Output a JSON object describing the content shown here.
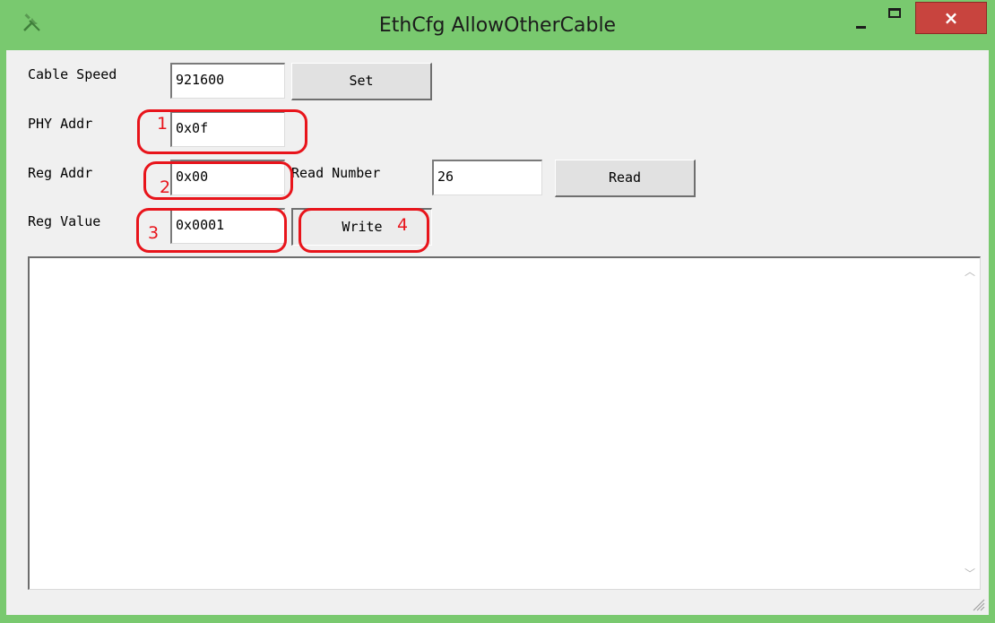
{
  "window": {
    "title": "EthCfg AllowOtherCable",
    "icon": "tools-icon",
    "controls": {
      "minimize": "minimize-icon",
      "maximize": "maximize-icon",
      "close": "×"
    }
  },
  "form": {
    "cable_speed": {
      "label": "Cable Speed",
      "value": "921600",
      "button": "Set"
    },
    "phy_addr": {
      "label": "PHY Addr",
      "value": "0x0f"
    },
    "reg_addr": {
      "label": "Reg Addr",
      "value": "0x00"
    },
    "read_number": {
      "label": "Read Number",
      "value": "26",
      "button": "Read"
    },
    "reg_value": {
      "label": "Reg Value",
      "value": "0x0001",
      "button": "Write"
    }
  },
  "output": {
    "text": ""
  },
  "annotations": [
    {
      "number": "1",
      "target": "phy-addr-field"
    },
    {
      "number": "2",
      "target": "reg-addr-field"
    },
    {
      "number": "3",
      "target": "reg-value-field"
    },
    {
      "number": "4",
      "target": "write-button"
    }
  ],
  "colors": {
    "title_bar": "#79c96f",
    "close_button": "#c8443e",
    "annotation": "#e8141b",
    "client_bg": "#f0f0f0"
  }
}
